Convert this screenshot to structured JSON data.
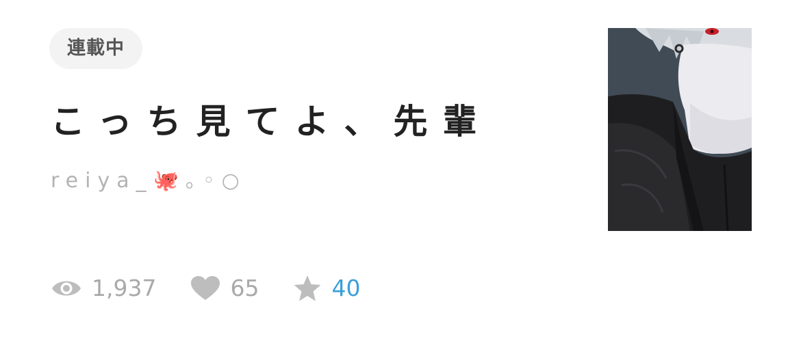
{
  "badge": {
    "label": "連載中"
  },
  "story": {
    "title": "こっち見てよ、先輩",
    "author": "reiya_🐙｡◦○"
  },
  "stats": {
    "views": "1,937",
    "likes": "65",
    "stars": "40"
  },
  "colors": {
    "accent": "#3a9fd8",
    "muted": "#a9a9a9",
    "title": "#222222",
    "badge_bg": "#f3f3f3"
  },
  "icons": {
    "views": "eye-icon",
    "likes": "heart-icon",
    "stars": "star-icon"
  }
}
